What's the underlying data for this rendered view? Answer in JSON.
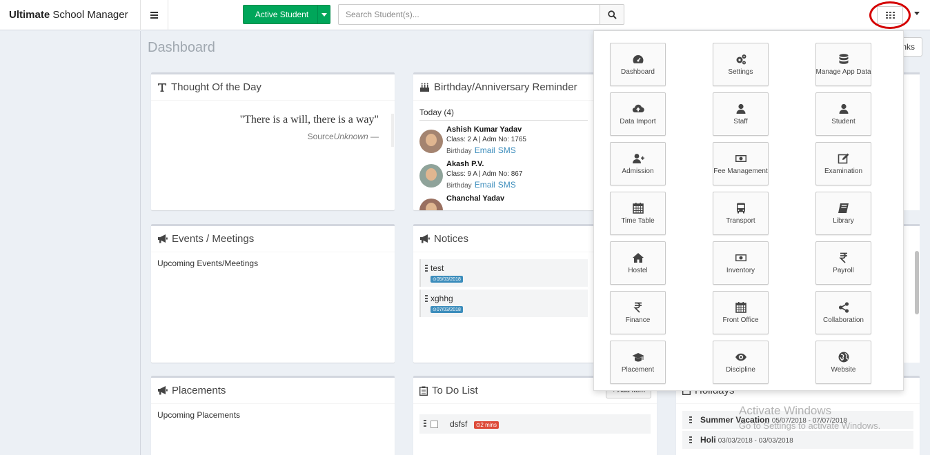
{
  "header": {
    "brand_bold": "Ultimate",
    "brand_rest": "School Manager",
    "active_student_label": "Active Student",
    "search_placeholder": "Search Student(s)..."
  },
  "page": {
    "title": "Dashboard",
    "links_label": "Links"
  },
  "thought": {
    "title": "Thought Of the Day",
    "quote": "\"There is a will, there is a way\"",
    "source_prefix": "Source",
    "source_name": "Unknown",
    "source_suffix": " —"
  },
  "birthday": {
    "title": "Birthday/Anniversary Reminder",
    "today_label": "Today (4)",
    "people": [
      {
        "name": "Ashish Kumar Yadav",
        "class_info": "Class: 2 A | Adm No: 1765",
        "kind": "Birthday",
        "email": "Email",
        "sms": "SMS"
      },
      {
        "name": "Akash P.V.",
        "class_info": "Class: 9 A | Adm No: 867",
        "kind": "Birthday",
        "email": "Email",
        "sms": "SMS"
      },
      {
        "name": "Chanchal Yadav"
      }
    ]
  },
  "events": {
    "title": "Events / Meetings",
    "subtitle": "Upcoming Events/Meetings"
  },
  "notices": {
    "title": "Notices",
    "items": [
      {
        "title": "test",
        "date": "05/03/2018"
      },
      {
        "title": "xghhg",
        "date": "07/03/2018"
      }
    ]
  },
  "placements": {
    "title": "Placements",
    "subtitle": "Upcoming Placements"
  },
  "todo": {
    "title": "To Do List",
    "add_label": "Add Item",
    "items": [
      {
        "text": "dsfsf",
        "badge": "2 mins"
      }
    ]
  },
  "holidays": {
    "title": "Holidays",
    "items": [
      {
        "name": "Summer Vacation",
        "dates": "05/07/2018 - 07/07/2018"
      },
      {
        "name": "Holi",
        "dates": "03/03/2018 - 03/03/2018"
      }
    ]
  },
  "apps_menu": {
    "tiles": [
      {
        "label": "Dashboard",
        "icon": "dashboard-icon"
      },
      {
        "label": "Settings",
        "icon": "gears-icon"
      },
      {
        "label": "Manage App Data",
        "icon": "database-icon"
      },
      {
        "label": "Data Import",
        "icon": "cloud-upload-icon"
      },
      {
        "label": "Staff",
        "icon": "user-icon"
      },
      {
        "label": "Student",
        "icon": "user-icon"
      },
      {
        "label": "Admission",
        "icon": "user-plus-icon"
      },
      {
        "label": "Fee Management",
        "icon": "money-icon"
      },
      {
        "label": "Examination",
        "icon": "edit-icon"
      },
      {
        "label": "Time Table",
        "icon": "calendar-icon"
      },
      {
        "label": "Transport",
        "icon": "bus-icon"
      },
      {
        "label": "Library",
        "icon": "book-icon"
      },
      {
        "label": "Hostel",
        "icon": "home-icon"
      },
      {
        "label": "Inventory",
        "icon": "money-icon"
      },
      {
        "label": "Payroll",
        "icon": "rupee-icon"
      },
      {
        "label": "Finance",
        "icon": "rupee-icon"
      },
      {
        "label": "Front Office",
        "icon": "calendar-icon"
      },
      {
        "label": "Collaboration",
        "icon": "share-icon"
      },
      {
        "label": "Placement",
        "icon": "graduation-cap-icon"
      },
      {
        "label": "Discipline",
        "icon": "eye-icon"
      },
      {
        "label": "Website",
        "icon": "globe-icon"
      }
    ]
  },
  "watermark": {
    "line1": "Activate Windows",
    "line2": "Go to Settings to activate Windows."
  },
  "colors": {
    "accent_green": "#00a65a",
    "link_blue": "#3c8dbc",
    "badge_red": "#dd4b39",
    "highlight_red": "#d40000"
  }
}
